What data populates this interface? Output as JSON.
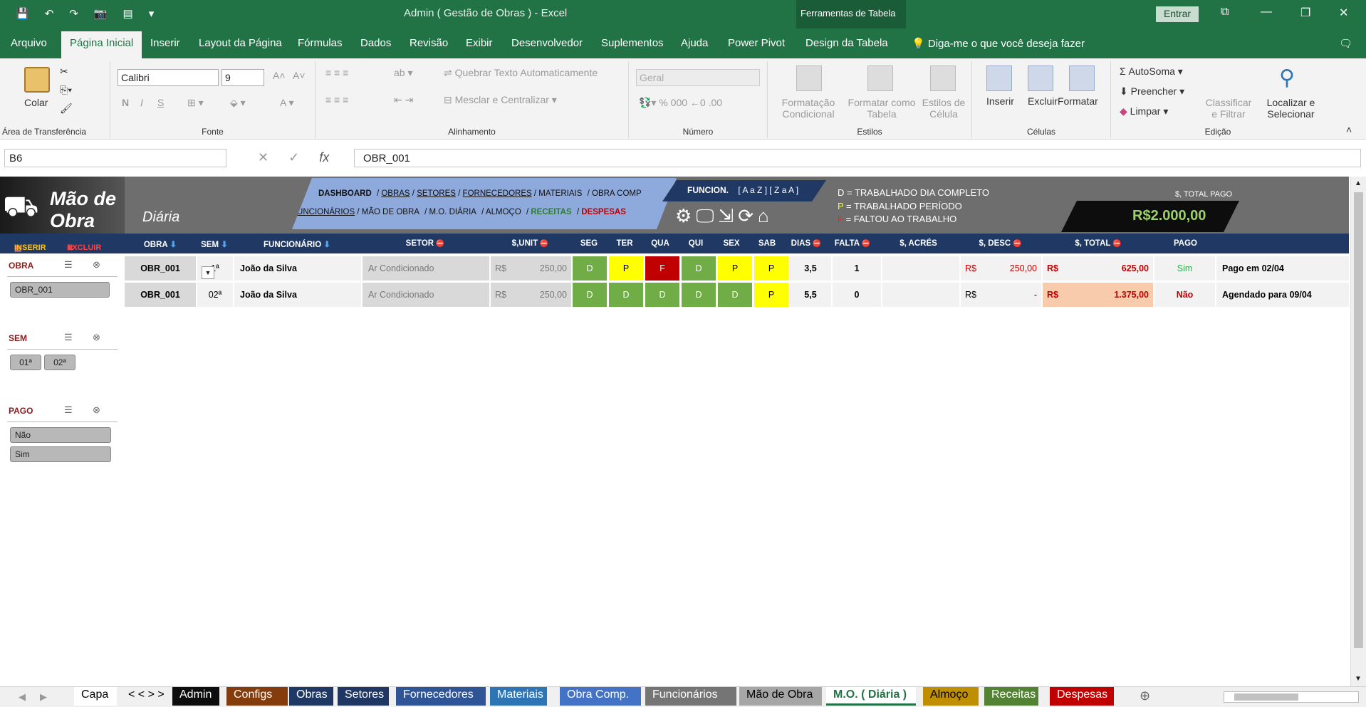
{
  "window": {
    "title": "Admin ( Gestão de Obras )  -  Excel",
    "tool_tab": "Ferramentas de Tabela",
    "signin": "Entrar"
  },
  "menu": [
    "Arquivo",
    "Página Inicial",
    "Inserir",
    "Layout da Página",
    "Fórmulas",
    "Dados",
    "Revisão",
    "Exibir",
    "Desenvolvedor",
    "Suplementos",
    "Ajuda",
    "Power Pivot",
    "Design da Tabela"
  ],
  "tell_me": "Diga-me o que você deseja fazer",
  "ribbon": {
    "clipboard": {
      "paste": "Colar",
      "group": "Área de Transferência"
    },
    "font": {
      "name": "Calibri",
      "size": "9",
      "group": "Fonte",
      "bold": "N",
      "italic": "I",
      "underline": "S"
    },
    "alignment": {
      "wrap": "Quebrar Texto Automaticamente",
      "merge": "Mesclar e Centralizar",
      "group": "Alinhamento"
    },
    "number": {
      "format": "Geral",
      "group": "Número"
    },
    "styles": {
      "cond": "Formatação Condicional",
      "table": "Formatar como Tabela",
      "cell": "Estilos de Célula",
      "group": "Estilos"
    },
    "cells": {
      "insert": "Inserir",
      "delete": "Excluir",
      "format": "Formatar",
      "group": "Células"
    },
    "editing": {
      "autosum": "AutoSoma",
      "fill": "Preencher",
      "clear": "Limpar",
      "sort": "Classificar e Filtrar",
      "find": "Localizar e Selecionar",
      "group": "Edição"
    }
  },
  "formula": {
    "namebox": "B6",
    "value": "OBR_001"
  },
  "banner": {
    "title1": "Mão de Obra",
    "title2": "Diária",
    "nav_row1": [
      "DASHBOARD",
      "OBRAS",
      "SETORES",
      "FORNECEDORES",
      "MATERIAIS",
      "OBRA COMP"
    ],
    "nav_row2": [
      "FUNCIONÁRIOS",
      "MÃO DE OBRA",
      "M.O. DIÁRIA",
      "ALMOÇO",
      "RECEITAS",
      "DESPESAS"
    ],
    "func_label": "FUNCION.",
    "func_sort": "[ A a Z ] [ Z a A ]",
    "legend": [
      {
        "k": "D",
        "t": " = TRABALHADO DIA COMPLETO",
        "c": "#ffffff"
      },
      {
        "k": "P",
        "t": " = TRABALHADO PERÍODO",
        "c": "#ffff00"
      },
      {
        "k": "F",
        "t": " = FALTOU AO TRABALHO",
        "c": "#ff2020"
      }
    ],
    "total_label": "$, TOTAL PAGO",
    "total_value": "R$2.000,00",
    "insert": "INSERIR",
    "delete": "EXCLUIR"
  },
  "headers": [
    "OBRA",
    "SEM",
    "FUNCIONÁRIO",
    "SETOR",
    "$,UNIT",
    "SEG",
    "TER",
    "QUA",
    "QUI",
    "SEX",
    "SAB",
    "DIAS",
    "FALTA",
    "$, ACRÉS",
    "$, DESC",
    "$, TOTAL",
    "PAGO"
  ],
  "rows": [
    {
      "obra": "OBR_001",
      "sem": "1ª",
      "func": "João da Silva",
      "setor": "Ar Condicionado",
      "cur": "R$",
      "unit": "250,00",
      "days": [
        "D",
        "P",
        "F",
        "D",
        "P",
        "P"
      ],
      "dias": "3,5",
      "falta": "1",
      "acres": "",
      "desc_cur": "R$",
      "desc": "250,00",
      "tot_cur": "R$",
      "total": "625,00",
      "pago": "Sim",
      "obs": "Pago em 02/04"
    },
    {
      "obra": "OBR_001",
      "sem": "02ª",
      "func": "João da Silva",
      "setor": "Ar Condicionado",
      "cur": "R$",
      "unit": "250,00",
      "days": [
        "D",
        "D",
        "D",
        "D",
        "D",
        "P"
      ],
      "dias": "5,5",
      "falta": "0",
      "acres": "",
      "desc_cur": "R$",
      "desc": "-",
      "tot_cur": "R$",
      "total": "1.375,00",
      "pago": "Não",
      "obs": "Agendado para 09/04"
    }
  ],
  "slicers": {
    "obra": {
      "title": "OBRA",
      "items": [
        "OBR_001"
      ]
    },
    "sem": {
      "title": "SEM",
      "items": [
        "01ª",
        "02ª"
      ]
    },
    "pago": {
      "title": "PAGO",
      "items": [
        "Não",
        "Sim"
      ]
    }
  },
  "sheet_tabs": [
    {
      "label": "Capa",
      "bg": "#ffffff",
      "fg": "#000"
    },
    {
      "label": "< < > >",
      "bg": "#f0f0f0",
      "fg": "#000"
    },
    {
      "label": "Admin",
      "bg": "#0d0d0d",
      "fg": "#fff"
    },
    {
      "label": "Configs",
      "bg": "#843c0c",
      "fg": "#fff"
    },
    {
      "label": "Obras",
      "bg": "#1f3864",
      "fg": "#fff"
    },
    {
      "label": "Setores",
      "bg": "#203764",
      "fg": "#fff"
    },
    {
      "label": "Fornecedores",
      "bg": "#2f5597",
      "fg": "#fff"
    },
    {
      "label": "Materiais",
      "bg": "#2e75b6",
      "fg": "#fff"
    },
    {
      "label": "Obra Comp.",
      "bg": "#4472c4",
      "fg": "#fff"
    },
    {
      "label": "Funcionários",
      "bg": "#757575",
      "fg": "#fff"
    },
    {
      "label": "Mão de Obra",
      "bg": "#a6a6a6",
      "fg": "#000"
    },
    {
      "label": "M.O. ( Diária )",
      "bg": "#ffffff",
      "fg": "#217346"
    },
    {
      "label": "Almoço",
      "bg": "#bf8f00",
      "fg": "#000"
    },
    {
      "label": "Receitas",
      "bg": "#548235",
      "fg": "#fff"
    },
    {
      "label": "Despesas",
      "bg": "#c00000",
      "fg": "#fff"
    }
  ]
}
